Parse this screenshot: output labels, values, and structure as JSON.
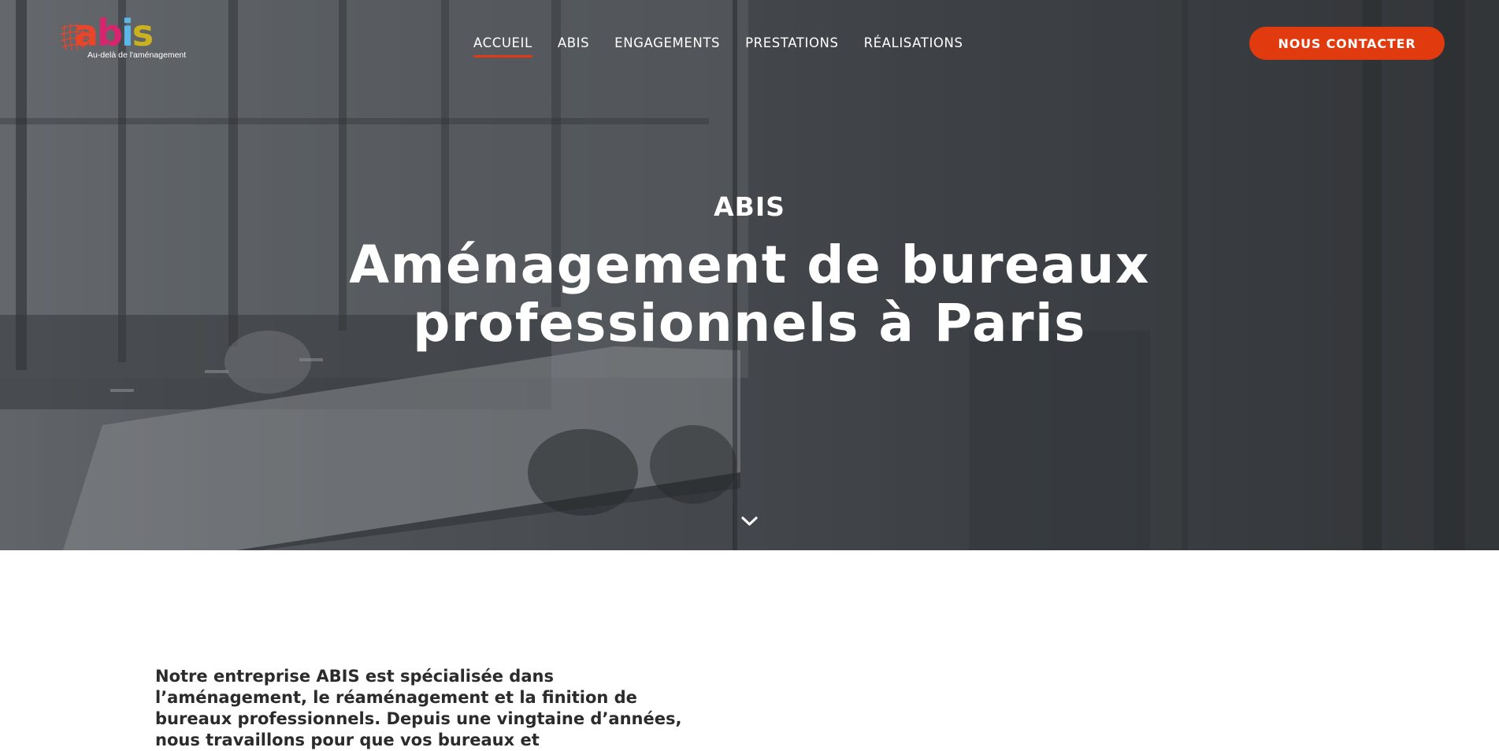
{
  "header": {
    "logo_text": {
      "a": "a",
      "b": "b",
      "i": "i",
      "s": "s"
    },
    "logo_tagline": "Au-delà de l'aménagement",
    "nav": [
      {
        "label": "ACCUEIL",
        "active": true
      },
      {
        "label": "ABIS",
        "active": false
      },
      {
        "label": "ENGAGEMENTS",
        "active": false
      },
      {
        "label": "PRESTATIONS",
        "active": false
      },
      {
        "label": "RÉALISATIONS",
        "active": false
      }
    ],
    "cta_label": "NOUS CONTACTER"
  },
  "hero": {
    "eyebrow": "ABIS",
    "title_line1": "Aménagement de bureaux",
    "title_line2": "professionnels à Paris",
    "scroll_icon": "chevron-down-icon"
  },
  "intro": {
    "text": "Notre entreprise ABIS est spécialisée dans l’aménagement, le réaménagement et la finition de bureaux professionnels. Depuis une vingtaine d’années, nous travaillons pour que vos bureaux et"
  },
  "colors": {
    "accent": "#e03a0e",
    "logo_a": "#e8452a",
    "logo_b": "#d6246e",
    "logo_i": "#5db7e6",
    "logo_s": "#c9b21e",
    "text_dark": "#2b2b2b"
  }
}
